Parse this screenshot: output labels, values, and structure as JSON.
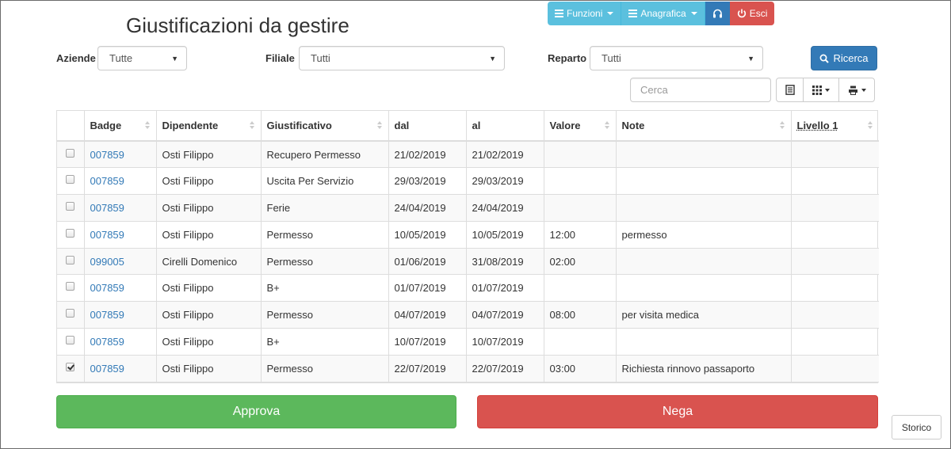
{
  "page_title": "Giustificazioni da gestire",
  "nav": {
    "funzioni": "Funzioni",
    "anagrafica": "Anagrafica",
    "esci": "Esci"
  },
  "filters": {
    "aziende_label": "Aziende",
    "aziende_value": "Tutte",
    "filiale_label": "Filiale",
    "filiale_value": "Tutti",
    "reparto_label": "Reparto",
    "reparto_value": "Tutti",
    "search_button": "Ricerca",
    "search_placeholder": "Cerca"
  },
  "table": {
    "columns": [
      "Badge",
      "Dipendente",
      "Giustificativo",
      "dal",
      "al",
      "Valore",
      "Note",
      "Livello 1"
    ],
    "rows": [
      {
        "checked": false,
        "badge": "007859",
        "dipendente": "Osti Filippo",
        "giustificativo": "Recupero Permesso",
        "dal": "21/02/2019",
        "al": "21/02/2019",
        "valore": "",
        "note": "",
        "livello1": ""
      },
      {
        "checked": false,
        "badge": "007859",
        "dipendente": "Osti Filippo",
        "giustificativo": "Uscita Per Servizio",
        "dal": "29/03/2019",
        "al": "29/03/2019",
        "valore": "",
        "note": "",
        "livello1": ""
      },
      {
        "checked": false,
        "badge": "007859",
        "dipendente": "Osti Filippo",
        "giustificativo": "Ferie",
        "dal": "24/04/2019",
        "al": "24/04/2019",
        "valore": "",
        "note": "",
        "livello1": ""
      },
      {
        "checked": false,
        "badge": "007859",
        "dipendente": "Osti Filippo",
        "giustificativo": "Permesso",
        "dal": "10/05/2019",
        "al": "10/05/2019",
        "valore": "12:00",
        "note": "permesso",
        "livello1": ""
      },
      {
        "checked": false,
        "badge": "099005",
        "dipendente": "Cirelli Domenico",
        "giustificativo": "Permesso",
        "dal": "01/06/2019",
        "al": "31/08/2019",
        "valore": "02:00",
        "note": "",
        "livello1": ""
      },
      {
        "checked": false,
        "badge": "007859",
        "dipendente": "Osti Filippo",
        "giustificativo": "B+",
        "dal": "01/07/2019",
        "al": "01/07/2019",
        "valore": "",
        "note": "",
        "livello1": ""
      },
      {
        "checked": false,
        "badge": "007859",
        "dipendente": "Osti Filippo",
        "giustificativo": "Permesso",
        "dal": "04/07/2019",
        "al": "04/07/2019",
        "valore": "08:00",
        "note": "per visita medica",
        "livello1": ""
      },
      {
        "checked": false,
        "badge": "007859",
        "dipendente": "Osti Filippo",
        "giustificativo": "B+",
        "dal": "10/07/2019",
        "al": "10/07/2019",
        "valore": "",
        "note": "",
        "livello1": ""
      },
      {
        "checked": true,
        "badge": "007859",
        "dipendente": "Osti Filippo",
        "giustificativo": "Permesso",
        "dal": "22/07/2019",
        "al": "22/07/2019",
        "valore": "03:00",
        "note": "Richiesta rinnovo passaporto",
        "livello1": ""
      }
    ]
  },
  "actions": {
    "approve": "Approva",
    "deny": "Nega",
    "history": "Storico"
  },
  "colors": {
    "primary": "#337ab7",
    "info": "#5bc0de",
    "success": "#5cb85c",
    "danger": "#d9534f"
  },
  "icons": {
    "funzioni": "list-icon",
    "anagrafica": "list-icon",
    "support": "headphones-icon",
    "esci": "power-icon",
    "search": "search-icon",
    "toggle_view": "card-view-icon",
    "columns": "columns-grid-icon",
    "export": "export-icon"
  }
}
